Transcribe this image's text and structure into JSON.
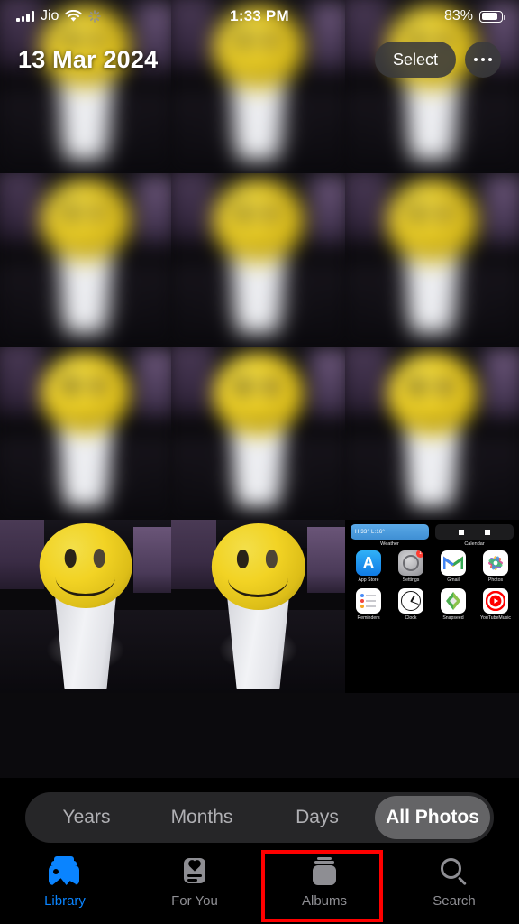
{
  "status_bar": {
    "carrier": "Jio",
    "signal_icon": "cellular-bars-icon",
    "wifi_icon": "wifi-icon",
    "activity_icon": "activity-spinner-icon",
    "time": "1:33 PM",
    "battery_percent": "83%",
    "battery_level": 83,
    "battery_icon": "battery-icon"
  },
  "header": {
    "title": "13 Mar 2024",
    "select_label": "Select",
    "more_icon": "more-ellipsis-icon"
  },
  "segmented_control": {
    "options": [
      {
        "label": "Years",
        "selected": false
      },
      {
        "label": "Months",
        "selected": false
      },
      {
        "label": "Days",
        "selected": false
      },
      {
        "label": "All Photos",
        "selected": true
      }
    ]
  },
  "tab_bar": {
    "tabs": [
      {
        "label": "Library",
        "icon": "photo-stack-icon",
        "active": true
      },
      {
        "label": "For You",
        "icon": "for-you-card-icon",
        "active": false
      },
      {
        "label": "Albums",
        "icon": "albums-box-icon",
        "active": false
      },
      {
        "label": "Search",
        "icon": "magnifier-icon",
        "active": false
      }
    ]
  },
  "annotation": {
    "target": "Albums",
    "color": "#ff0000"
  },
  "colors": {
    "accent": "#0a84ff",
    "inactive": "#8e8e93",
    "background": "#000000",
    "segment_track": "#28282a",
    "segment_selected": "#646466",
    "highlight": "#ff0000"
  },
  "photo_grid": {
    "columns": 3,
    "rows": [
      {
        "blurred": true,
        "cells": [
          {
            "subject": "smiley-face-ball-on-white-cup"
          },
          {
            "subject": "smiley-face-ball-on-white-cup"
          },
          {
            "subject": "smiley-face-ball-on-white-cup"
          }
        ]
      },
      {
        "blurred": true,
        "cells": [
          {
            "subject": "smiley-face-ball-on-white-cup"
          },
          {
            "subject": "smiley-face-ball-on-white-cup"
          },
          {
            "subject": "smiley-face-ball-on-white-cup"
          }
        ]
      },
      {
        "blurred": true,
        "cells": [
          {
            "subject": "smiley-face-ball-on-white-cup"
          },
          {
            "subject": "smiley-face-ball-on-white-cup"
          },
          {
            "subject": "smiley-face-ball-on-white-cup"
          }
        ]
      },
      {
        "blurred": false,
        "cells": [
          {
            "subject": "smiley-face-ball-on-white-cup"
          },
          {
            "subject": "smiley-face-ball-on-white-cup"
          },
          {
            "subject": "ios-home-screen-screenshot"
          }
        ]
      }
    ]
  },
  "home_screen_thumbnail": {
    "widgets": [
      {
        "name": "Weather",
        "text": "H:33° L:16°"
      },
      {
        "name": "Calendar",
        "text": ""
      }
    ],
    "apps_row_1": [
      {
        "name": "App Store",
        "badge": ""
      },
      {
        "name": "Settings",
        "badge": "1"
      },
      {
        "name": "Gmail",
        "badge": ""
      },
      {
        "name": "Photos",
        "badge": ""
      }
    ],
    "apps_row_2": [
      {
        "name": "Reminders",
        "badge": ""
      },
      {
        "name": "Clock",
        "badge": ""
      },
      {
        "name": "Snapseed",
        "badge": ""
      },
      {
        "name": "YouTubeMusic",
        "badge": ""
      }
    ]
  }
}
